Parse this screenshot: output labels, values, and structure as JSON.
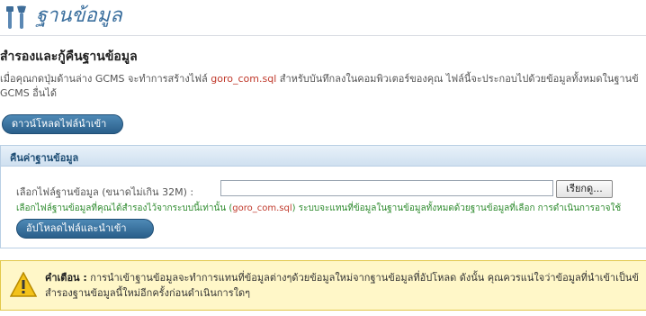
{
  "header": {
    "title": "ฐานข้อมูล",
    "icon": "tools-icon"
  },
  "backup": {
    "title": "สำรองและกู้คืนฐานข้อมูล",
    "desc_before": "เมื่อคุณกดปุ่มด้านล่าง GCMS จะทำการสร้างไฟล์ ",
    "desc_file": "goro_com.sql",
    "desc_after": " สำหรับบันทึกลงในคอมพิวเตอร์ของคุณ ไฟล์นี้จะประกอบไปด้วยข้อมูลทั้งหมดในฐานข้",
    "desc_line2": "GCMS อื่นได้",
    "download_label": "ดาวน์โหลดไฟล์นำเข้า"
  },
  "restore": {
    "title": "คืนค่าฐานข้อมูล",
    "file_label": "เลือกไฟล์ฐานข้อมูล (ขนาดไม่เกิน 32M) :",
    "file_value": "",
    "browse_label": "เรียกดู...",
    "hint_before": "เลือกไฟล์ฐานข้อมูลที่คุณได้สำรองไว้จากระบบนี้เท่านั้น (",
    "hint_file": "goro_com.sql",
    "hint_after": ") ระบบจะแทนที่ข้อมูลในฐานข้อมูลทั้งหมดด้วยฐานข้อมูลที่เลือก การดำเนินการอาจใช้",
    "upload_label": "อัปโหลดไฟล์และนำเข้า"
  },
  "warning": {
    "label": "คำเตือน :",
    "line1": " การนำเข้าฐานข้อมูลจะทำการแทนที่ข้อมูลต่างๆด้วยข้อมูลใหม่จากฐานข้อมูลที่อัปโหลด ดังนั้น คุณควรแน่ใจว่าข้อมูลที่นำเข้าเป็นข้",
    "line2": "สำรองฐานข้อมูลนี้ใหม่อีกครั้งก่อนดำเนินการใดๆ",
    "icon": "warning-icon"
  },
  "colors": {
    "accent": "#3b6f9e",
    "button": "#2a5f8a",
    "highlight": "#c0392b",
    "hint": "#2e8b2e",
    "warning_bg": "#fff7c8"
  }
}
